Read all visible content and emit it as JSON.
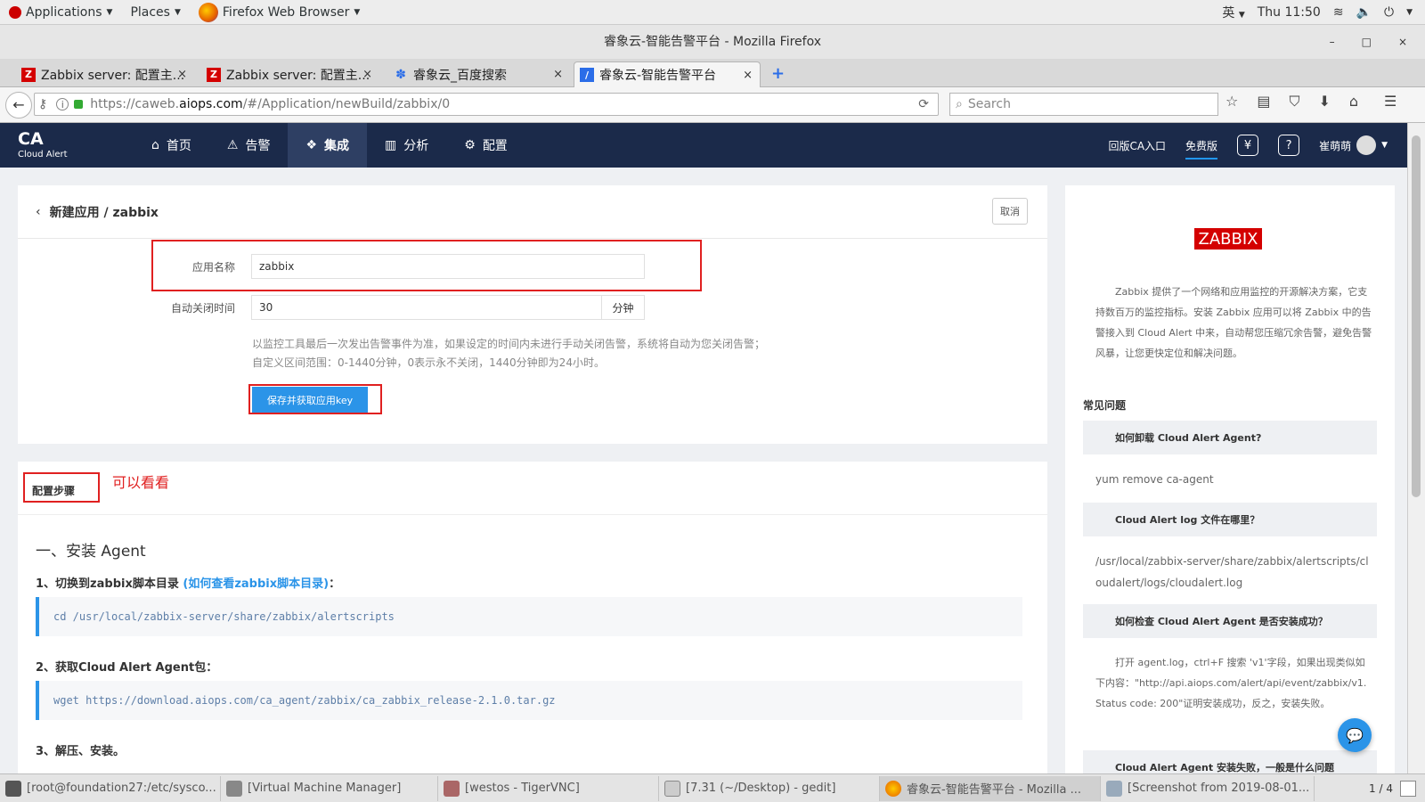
{
  "gnome": {
    "applications": "Applications",
    "places": "Places",
    "firefox": "Firefox Web Browser",
    "input_method": "英",
    "clock": "Thu 11:50"
  },
  "window": {
    "title": "睿象云-智能告警平台 - Mozilla Firefox",
    "minimize": "–",
    "maximize": "□",
    "close": "×"
  },
  "tabs": [
    {
      "label": "Zabbix server: 配置主...",
      "close": "×"
    },
    {
      "label": "Zabbix server: 配置主...",
      "close": "×"
    },
    {
      "label": "睿象云_百度搜索",
      "close": "×"
    },
    {
      "label": "睿象云-智能告警平台",
      "close": "×"
    }
  ],
  "new_tab": "+",
  "url": {
    "prefix": "https://caweb.",
    "domain": "aiops.com",
    "suffix": "/#/Application/newBuild/zabbix/0"
  },
  "search_placeholder": "Search",
  "app": {
    "logo_big": "CA",
    "logo_small": "Cloud Alert",
    "nav": [
      {
        "label": "首页"
      },
      {
        "label": "告警"
      },
      {
        "label": "集成"
      },
      {
        "label": "分析"
      },
      {
        "label": "配置"
      }
    ],
    "old_version": "回版CA入口",
    "free": "免费版",
    "user": "崔萌萌"
  },
  "form": {
    "breadcrumb": "新建应用 / zabbix",
    "cancel": "取消",
    "name_label": "应用名称",
    "name_value": "zabbix",
    "close_label": "自动关闭时间",
    "close_value": "30",
    "close_unit": "分钟",
    "hint1": "以监控工具最后一次发出告警事件为准，如果设定的时间内未进行手动关闭告警，系统将自动为您关闭告警；",
    "hint2": "自定义区间范围：0-1440分钟，0表示永不关闭，1440分钟即为24小时。",
    "save": "保存并获取应用key"
  },
  "steps": {
    "title": "配置步骤",
    "note": "可以看看",
    "h1": "一、安装 Agent",
    "s1": "1、切换到zabbix脚本目录",
    "s1_link": "(如何查看zabbix脚本目录)",
    "s1_colon": "：",
    "code1": "cd /usr/local/zabbix-server/share/zabbix/alertscripts",
    "s2": "2、获取Cloud Alert Agent包：",
    "code2": "wget https://download.aiops.com/ca_agent/zabbix/ca_zabbix_release-2.1.0.tar.gz",
    "s3": "3、解压、安装。"
  },
  "side": {
    "logo": "ZABBIX",
    "desc": "Zabbix 提供了一个网络和应用监控的开源解决方案，它支持数百万的监控指标。安装 Zabbix 应用可以将 Zabbix 中的告警接入到 Cloud Alert 中来，自动帮您压缩冗余告警，避免告警风暴，让您更快定位和解决问题。",
    "faq_title": "常见问题",
    "faq": [
      {
        "q": "如何卸载 Cloud Alert Agent?",
        "a": "yum remove ca-agent"
      },
      {
        "q": "Cloud Alert log 文件在哪里？",
        "a": "/usr/local/zabbix-server/share/zabbix/alertscripts/cloudalert/logs/cloudalert.log"
      },
      {
        "q": "如何检查 Cloud Alert Agent 是否安装成功？",
        "a": "打开 agent.log，ctrl+F 搜索 'v1'字段，如果出现类似如下内容：\"http://api.aiops.com/alert/api/event/zabbix/v1. Status code: 200\"证明安装成功，反之，安装失败。"
      },
      {
        "q": "Cloud Alert Agent 安装失败，一般是什么问题",
        "a": ""
      }
    ]
  },
  "taskbar": [
    {
      "label": "[root@foundation27:/etc/sysco..."
    },
    {
      "label": "[Virtual Machine Manager]"
    },
    {
      "label": "[westos - TigerVNC]"
    },
    {
      "label": "[7.31 (~/Desktop) - gedit]"
    },
    {
      "label": "睿象云-智能告警平台 - Mozilla ..."
    },
    {
      "label": "[Screenshot from 2019-08-01..."
    }
  ],
  "pager": "1 / 4"
}
